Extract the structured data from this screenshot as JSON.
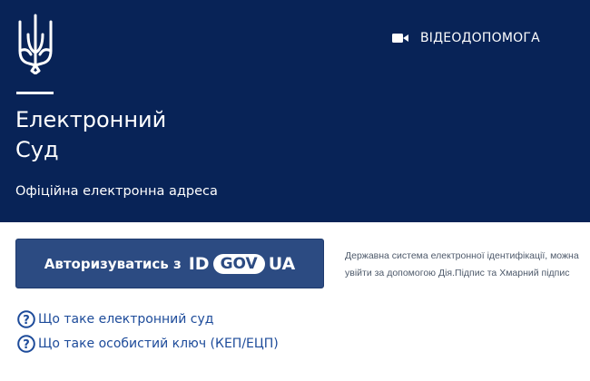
{
  "header": {
    "title_line1": "Електронний",
    "title_line2": "Суд",
    "subtitle": "Офіційна електронна адреса",
    "video_help_label": "ВІДЕОДОПОМОГА",
    "emblem_icon": "trident-icon",
    "video_icon": "video-camera-icon",
    "background_color": "#082357"
  },
  "auth": {
    "button_label": "Авторизуватись з",
    "id_gov_logo": [
      "ID",
      "GOV",
      "UA"
    ],
    "info_text": "Державна система електронної ідентифікації, можна увійти за допомогою Дія.Підпис та Хмарний підпис",
    "button_color": "#2c4b82"
  },
  "help_links": [
    {
      "label": "Що таке електронний суд",
      "icon": "question-circle-icon"
    },
    {
      "label": "Що таке особистий ключ (КЕП/ЕЦП)",
      "icon": "question-circle-icon"
    }
  ],
  "colors": {
    "link": "#1d4b9a"
  }
}
